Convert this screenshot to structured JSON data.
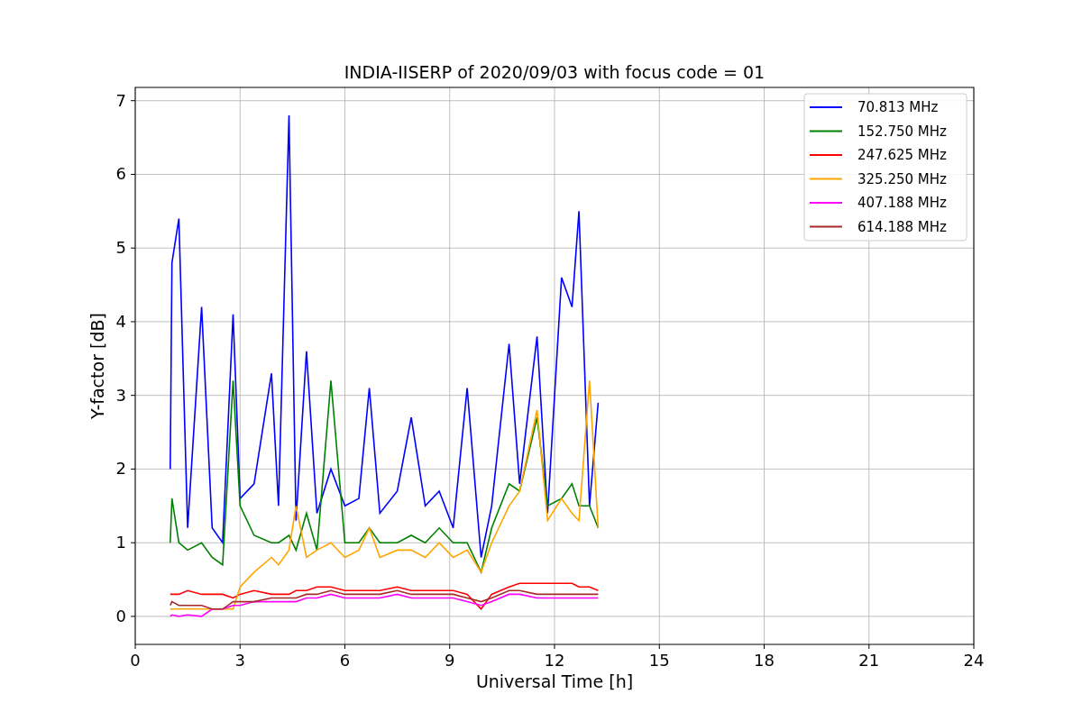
{
  "chart_data": {
    "type": "line",
    "title": "INDIA-IISERP of 2020/09/03 with focus code = 01",
    "xlabel": "Universal Time [h]",
    "ylabel": "Y-factor [dB]",
    "xlim": [
      0,
      24
    ],
    "ylim": [
      -0.38,
      7.18
    ],
    "xticks": [
      0,
      3,
      6,
      9,
      12,
      15,
      18,
      21,
      24
    ],
    "yticks": [
      0,
      1,
      2,
      3,
      4,
      5,
      6,
      7
    ],
    "grid": true,
    "legend": true,
    "x": [
      1.0,
      1.05,
      1.25,
      1.5,
      1.9,
      2.2,
      2.5,
      2.8,
      3.0,
      3.4,
      3.9,
      4.1,
      4.4,
      4.6,
      4.9,
      5.2,
      5.6,
      6.0,
      6.4,
      6.7,
      7.0,
      7.5,
      7.9,
      8.3,
      8.7,
      9.1,
      9.5,
      9.9,
      10.2,
      10.7,
      11.0,
      11.5,
      11.8,
      12.2,
      12.5,
      12.7,
      13.0,
      13.25
    ],
    "series": [
      {
        "name": "70.813 MHz",
        "color": "#0000ff",
        "values": [
          2.0,
          4.8,
          5.4,
          1.2,
          4.2,
          1.2,
          1.0,
          4.1,
          1.6,
          1.8,
          3.3,
          1.5,
          6.8,
          1.3,
          3.6,
          1.4,
          2.0,
          1.5,
          1.6,
          3.1,
          1.4,
          1.7,
          2.7,
          1.5,
          1.7,
          1.2,
          3.1,
          0.8,
          1.5,
          3.7,
          1.8,
          3.8,
          1.4,
          4.6,
          4.2,
          5.5,
          1.5,
          2.9
        ]
      },
      {
        "name": "152.750 MHz",
        "color": "#008000",
        "values": [
          1.0,
          1.6,
          1.0,
          0.9,
          1.0,
          0.8,
          0.7,
          3.2,
          1.5,
          1.1,
          1.0,
          1.0,
          1.1,
          0.9,
          1.4,
          0.9,
          3.2,
          1.0,
          1.0,
          1.2,
          1.0,
          1.0,
          1.1,
          1.0,
          1.2,
          1.0,
          1.0,
          0.6,
          1.2,
          1.8,
          1.7,
          2.7,
          1.5,
          1.6,
          1.8,
          1.5,
          1.5,
          1.2
        ]
      },
      {
        "name": "247.625 MHz",
        "color": "#ff0000",
        "values": [
          0.3,
          0.3,
          0.3,
          0.35,
          0.3,
          0.3,
          0.3,
          0.25,
          0.3,
          0.35,
          0.3,
          0.3,
          0.3,
          0.35,
          0.35,
          0.4,
          0.4,
          0.35,
          0.35,
          0.35,
          0.35,
          0.4,
          0.35,
          0.35,
          0.35,
          0.35,
          0.3,
          0.1,
          0.3,
          0.4,
          0.45,
          0.45,
          0.45,
          0.45,
          0.45,
          0.4,
          0.4,
          0.35
        ]
      },
      {
        "name": "325.250 MHz",
        "color": "#ffa500",
        "values": [
          0.1,
          0.1,
          0.1,
          0.1,
          0.1,
          0.1,
          0.1,
          0.1,
          0.4,
          0.6,
          0.8,
          0.7,
          0.9,
          1.5,
          0.8,
          0.9,
          1.0,
          0.8,
          0.9,
          1.2,
          0.8,
          0.9,
          0.9,
          0.8,
          1.0,
          0.8,
          0.9,
          0.6,
          1.0,
          1.5,
          1.7,
          2.8,
          1.3,
          1.6,
          1.4,
          1.3,
          3.2,
          1.2
        ]
      },
      {
        "name": "407.188 MHz",
        "color": "#ff00ff",
        "values": [
          0.0,
          0.02,
          0.0,
          0.02,
          0.0,
          0.1,
          0.1,
          0.15,
          0.15,
          0.2,
          0.2,
          0.2,
          0.2,
          0.2,
          0.25,
          0.25,
          0.3,
          0.25,
          0.25,
          0.25,
          0.25,
          0.3,
          0.25,
          0.25,
          0.25,
          0.25,
          0.2,
          0.15,
          0.2,
          0.3,
          0.3,
          0.25,
          0.25,
          0.25,
          0.25,
          0.25,
          0.25,
          0.25
        ]
      },
      {
        "name": "614.188 MHz",
        "color": "#a52a2a",
        "values": [
          0.15,
          0.2,
          0.15,
          0.15,
          0.15,
          0.1,
          0.1,
          0.2,
          0.2,
          0.2,
          0.25,
          0.25,
          0.25,
          0.25,
          0.3,
          0.3,
          0.35,
          0.3,
          0.3,
          0.3,
          0.3,
          0.35,
          0.3,
          0.3,
          0.3,
          0.3,
          0.25,
          0.2,
          0.25,
          0.35,
          0.35,
          0.3,
          0.3,
          0.3,
          0.3,
          0.3,
          0.3,
          0.3
        ]
      }
    ]
  }
}
